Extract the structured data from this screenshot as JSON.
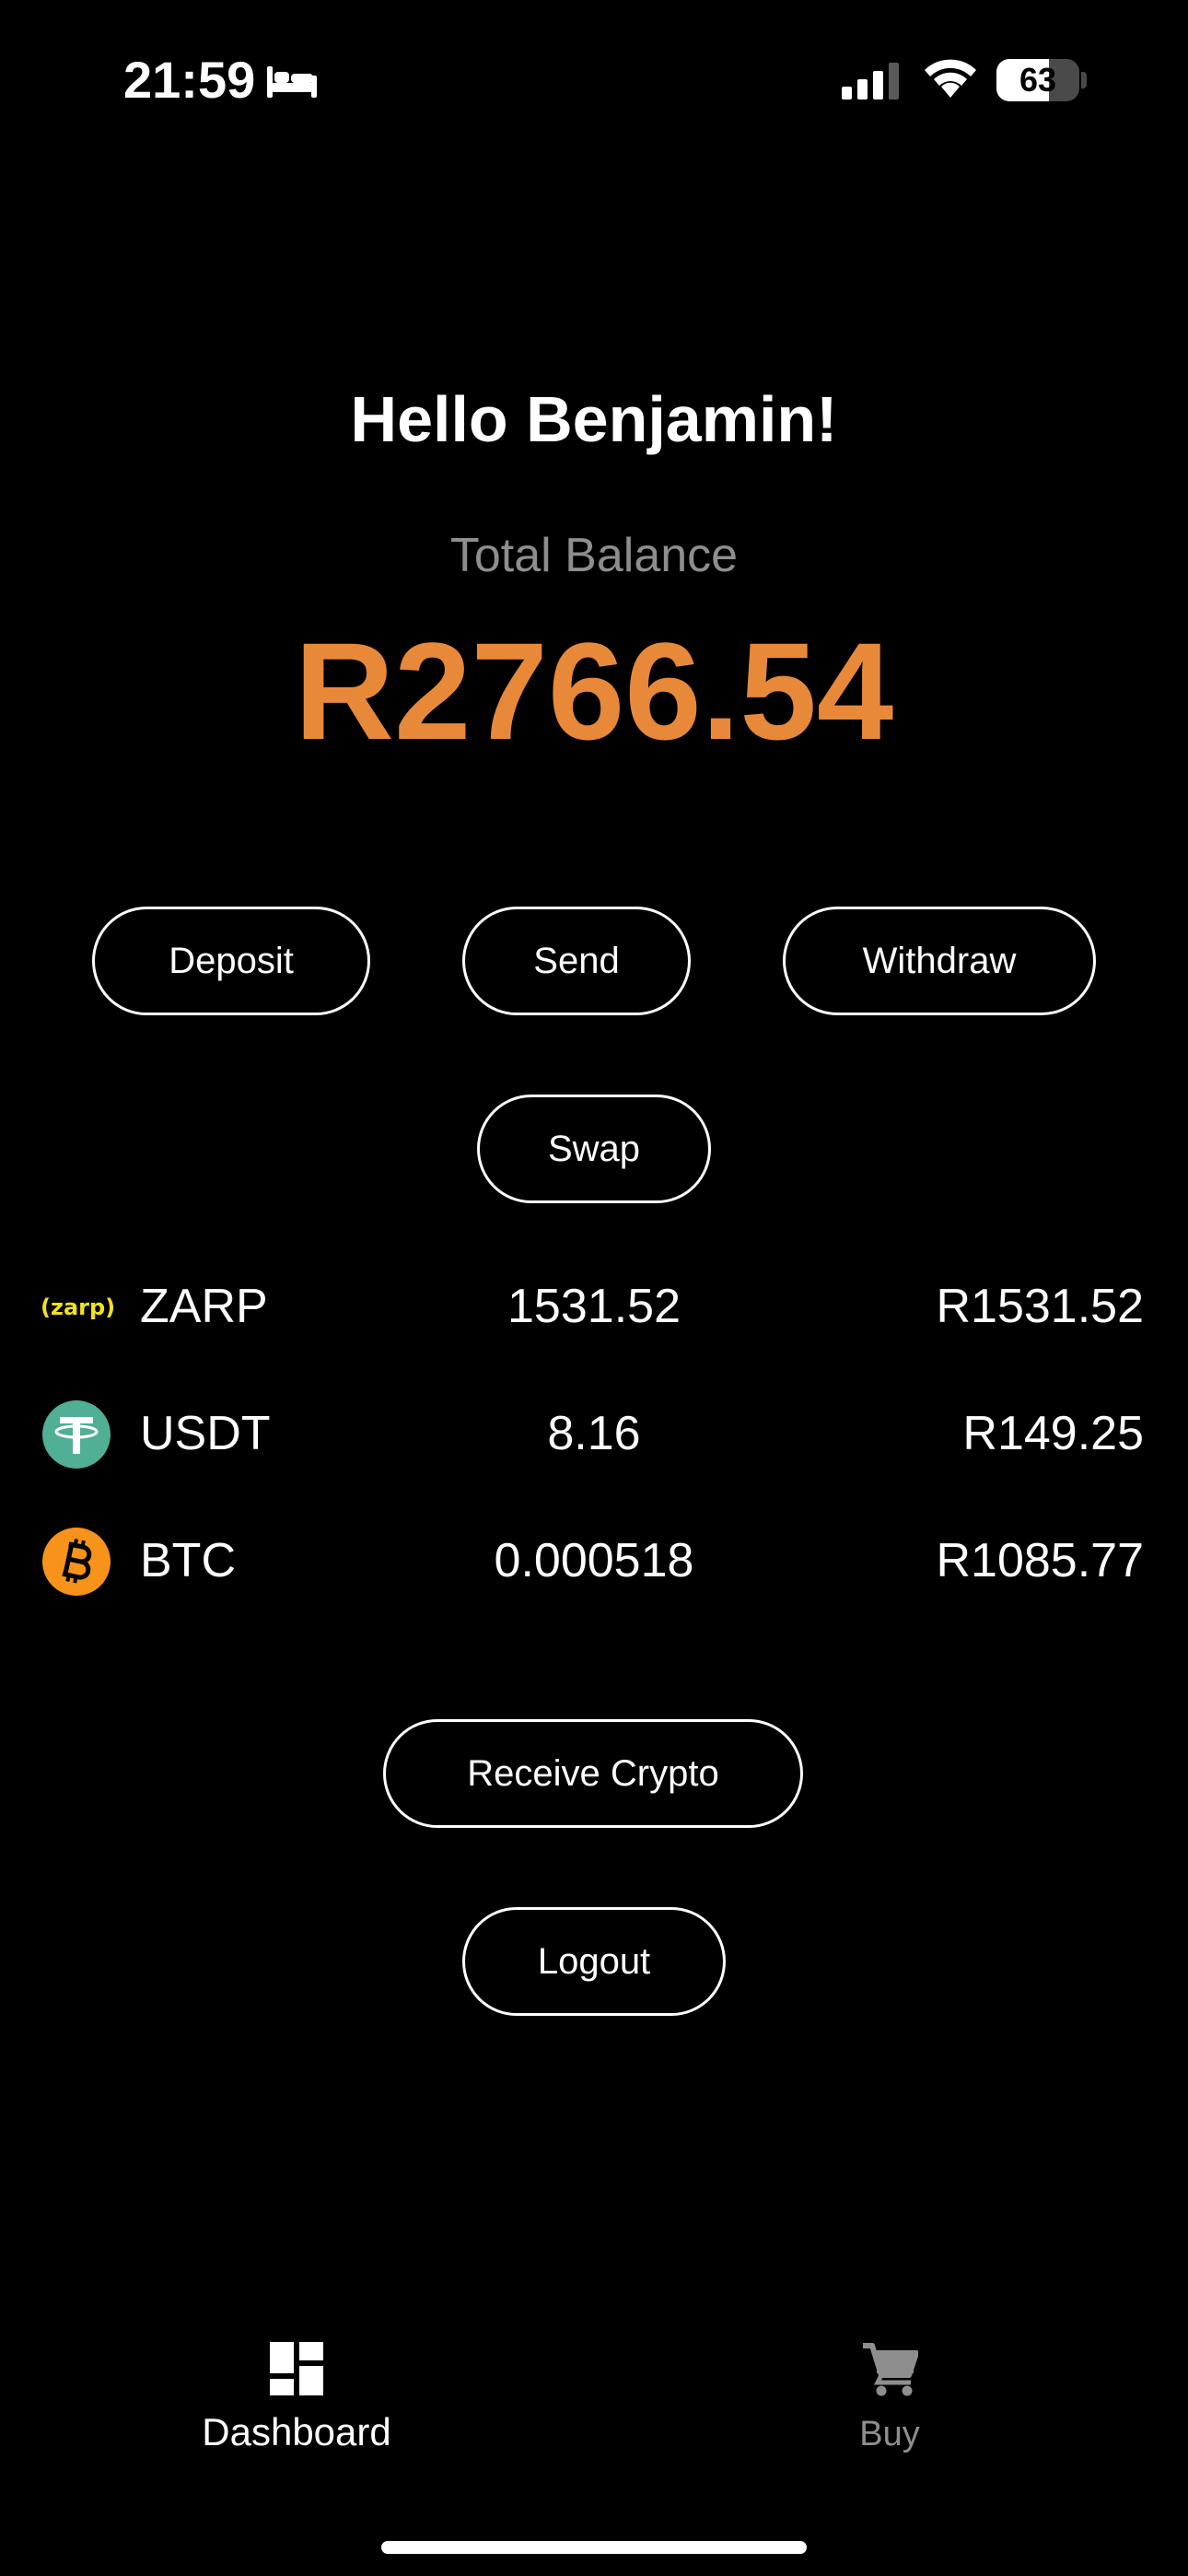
{
  "status_bar": {
    "time": "21:59",
    "focus_icon": "bed-icon",
    "battery_level": 63,
    "battery_text": "63"
  },
  "header": {
    "greeting": "Hello Benjamin!",
    "balance_label": "Total Balance",
    "balance_value": "R2766.54"
  },
  "actions": {
    "deposit": "Deposit",
    "send": "Send",
    "withdraw": "Withdraw",
    "swap": "Swap"
  },
  "assets": [
    {
      "symbol": "ZARP",
      "logo_text": "(zarp)",
      "icon": "zarp-logo",
      "amount": "1531.52",
      "value": "R1531.52"
    },
    {
      "symbol": "USDT",
      "icon": "tether-icon",
      "amount": "8.16",
      "value": "R149.25"
    },
    {
      "symbol": "BTC",
      "icon": "bitcoin-icon",
      "amount": "0.000518",
      "value": "R1085.77"
    }
  ],
  "footer_actions": {
    "receive": "Receive Crypto",
    "logout": "Logout"
  },
  "nav": {
    "dashboard": "Dashboard",
    "buy": "Buy"
  },
  "colors": {
    "background": "#000000",
    "accent": "#e8893a",
    "muted": "#8e8e8e",
    "tether": "#50af95",
    "bitcoin": "#f7931a",
    "zarp": "#f2e21b"
  }
}
